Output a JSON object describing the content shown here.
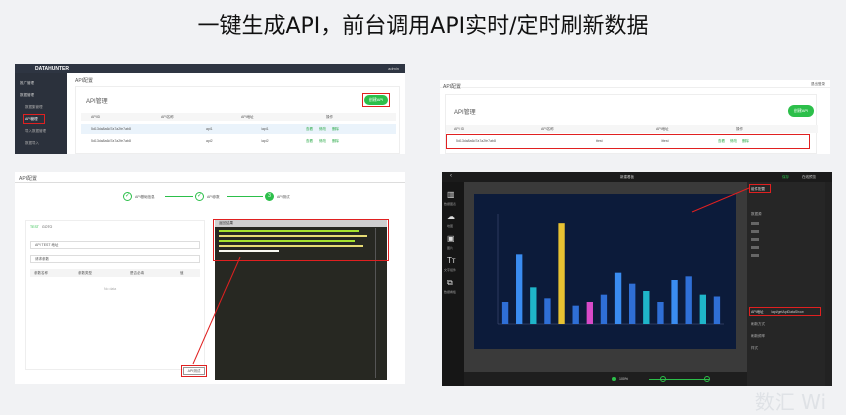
{
  "page_title": "一键生成API，前台调用API实时/定时刷新数据",
  "panel1": {
    "brand": "DATAHUNTER",
    "header_right": "admin",
    "sidebar": [
      "推广管理",
      "数据管理",
      "数据集管理",
      "API管理",
      "导入数据管理",
      "数据导入"
    ],
    "page_heading": "API配置",
    "section": "API管理",
    "button": "创建API",
    "columns": [
      "APIID",
      "API名称",
      "API地址",
      "操作"
    ],
    "rows": [
      {
        "id": "5d13da8a6d7a7a2fe7ab8",
        "name": "api1",
        "addr": "/api1"
      },
      {
        "id": "5d13da8a6d7a7a2fe7ab8",
        "name": "api2",
        "addr": "/api2"
      }
    ],
    "actions": [
      "查看",
      "修改",
      "删除"
    ]
  },
  "panel2": {
    "header_right": "退出登录",
    "page_heading": "API配置",
    "section": "API管理",
    "button": "创建API",
    "columns": [
      "API ID",
      "API名称",
      "API地址",
      "操作"
    ],
    "row": {
      "id": "5d13da8a6d7a7a2fe7ab8",
      "name": "ttest",
      "addr": "/ttest"
    },
    "actions": [
      "查看",
      "修改",
      "删除"
    ]
  },
  "panel3": {
    "page_heading": "API配置",
    "steps": [
      "API基础信息",
      "API参数",
      "API测试"
    ],
    "step_number": "3",
    "left_tab": [
      "TEST",
      "GOTO"
    ],
    "fields": [
      "API TEST 地址",
      "请求参数"
    ],
    "table_cols": [
      "参数名称",
      "参数类型",
      "是否必填",
      "值"
    ],
    "nodata": "No data",
    "right_label": "返回结果",
    "test_button": "API测试"
  },
  "panel4": {
    "topbar_title": "新建看板",
    "topbar_right": [
      "保存",
      "在线预览"
    ],
    "tools": [
      "数据图表",
      "地图",
      "图片",
      "文字组件",
      "数据看板"
    ],
    "props_title": "组件配置",
    "props": [
      "数据源",
      "API地址",
      "刷新方式",
      "刷新频率",
      "样式"
    ],
    "api_value": "/api/getApiDataShow",
    "zoom": "100%"
  },
  "chart_data": {
    "type": "bar",
    "values": [
      12,
      38,
      20,
      14,
      55,
      10,
      12,
      16,
      28,
      22,
      18,
      12,
      24,
      26,
      16,
      15
    ],
    "ylim": [
      0,
      60
    ]
  },
  "watermark": "数汇 Wi"
}
